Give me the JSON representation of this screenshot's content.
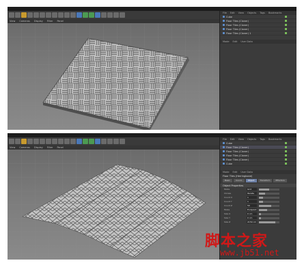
{
  "screenshot_top": {
    "viewport_menu": [
      "View",
      "Cameras",
      "Display",
      "Filter",
      "Panel"
    ],
    "objects_menu": [
      "File",
      "Edit",
      "View",
      "Objects",
      "Tags",
      "Bookmarks"
    ],
    "objects": [
      "Cube",
      "Floor Tiles (Cloner)",
      "Floor Tiles (Cloner)",
      "Floor Tiles (Cloner)",
      "Floor Tiles (Cloner) 1"
    ],
    "attributes_menu": [
      "Mode",
      "Edit",
      "User Data"
    ]
  },
  "screenshot_bottom": {
    "viewport_menu": [
      "View",
      "Cameras",
      "Display",
      "Filter",
      "Panel"
    ],
    "objects_menu": [
      "File",
      "Edit",
      "View",
      "Objects",
      "Tags",
      "Bookmarks"
    ],
    "objects": [
      "Cube",
      "Floor Tiles (Cloner)",
      "Floor Tiles (Cloner)",
      "Floor Tiles (Cloner)",
      "Floor Tiles (Cloner)",
      "Cube"
    ],
    "attributes_menu": [
      "Mode",
      "Edit",
      "User Data"
    ],
    "attr_title": "Floor Tiles (Herringbone)",
    "attr_tabs": [
      "Basic",
      "Coord.",
      "Object",
      "Transform",
      "Effectors"
    ],
    "attr_section": "Object Properties",
    "attr_rows": [
      {
        "label": "Mode",
        "value": "Grid",
        "level": 0.5
      },
      {
        "label": "Clones",
        "value": "Iterate",
        "level": 0.3
      },
      {
        "label": "Count X",
        "value": "1",
        "level": 0.2
      },
      {
        "label": "Count Y",
        "value": "1",
        "level": 0.2
      },
      {
        "label": "Count Z",
        "value": "50",
        "level": 0.6
      },
      {
        "label": "Mode",
        "value": "Endpoint",
        "level": 0.4
      },
      {
        "label": "Size X",
        "value": "0 cm",
        "level": 0.1
      },
      {
        "label": "Size Y",
        "value": "0 cm",
        "level": 0.1
      },
      {
        "label": "Size Z",
        "value": "2150 cm",
        "level": 0.8
      }
    ]
  },
  "watermark": {
    "chinese": "脚本之家",
    "url": "www.jb51.net"
  }
}
